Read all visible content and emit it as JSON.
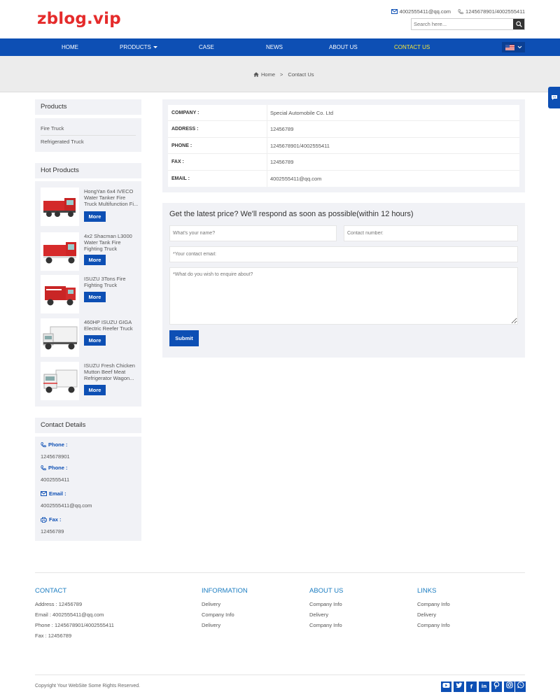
{
  "header": {
    "logo": "zblog.vip",
    "email": "4002555411@qq.com",
    "phone": "1245678901/4002555411",
    "search_placeholder": "Search here..."
  },
  "nav": {
    "items": [
      {
        "label": "HOME"
      },
      {
        "label": "PRODUCTS"
      },
      {
        "label": "CASE"
      },
      {
        "label": "NEWS"
      },
      {
        "label": "ABOUT US"
      },
      {
        "label": "CONTACT US"
      }
    ]
  },
  "breadcrumb": {
    "home": "Home",
    "sep": ">",
    "current": "Contact Us"
  },
  "sidebar": {
    "products_title": "Products",
    "products": [
      "Fire Truck",
      "Refrigerated Truck"
    ],
    "hot_title": "Hot Products",
    "more_label": "More",
    "hot": [
      {
        "name": "HongYan 6x4 IVECO Water Tanker Fire Truck Multifunction Fi..."
      },
      {
        "name": "4x2 Shacman L3000 Water Tank Fire Fighting Truck"
      },
      {
        "name": "ISUZU 3Tons Fire Fighting Truck"
      },
      {
        "name": "460HP ISUZU GIGA Electric Reefer Truck"
      },
      {
        "name": "ISUZU Fresh Chicken Mutton Beef Meat Refrigerator Wagon..."
      }
    ],
    "contact_title": "Contact Details",
    "contact": {
      "phone_label": "Phone :",
      "phone1": "1245678901",
      "phone2": "4002555411",
      "email_label": "Email :",
      "email": "4002555411@qq.com",
      "fax_label": "Fax :",
      "fax": "12456789"
    }
  },
  "info": {
    "rows": [
      {
        "key": "COMPANY :",
        "value": "Special Automobile Co. Ltd"
      },
      {
        "key": "ADDRESS :",
        "value": "12456789"
      },
      {
        "key": "PHONE :",
        "value": "1245678901/4002555411"
      },
      {
        "key": "FAX :",
        "value": "12456789"
      },
      {
        "key": "EMAIL :",
        "value": "4002555411@qq.com"
      }
    ]
  },
  "form": {
    "title": "Get the latest price? We'll respond as soon as possible(within 12 hours)",
    "name_placeholder": "What's your name?",
    "number_placeholder": "Contact number:",
    "email_placeholder": "*Your contact email:",
    "message_placeholder": "*What do you wish to enquire about?",
    "submit": "Submit"
  },
  "footer": {
    "contact": {
      "title": "CONTACT",
      "lines": [
        "Address : 12456789",
        "Email : 4002555411@qq.com",
        "Phone : 1245678901/4002555411",
        "Fax : 12456789"
      ]
    },
    "information": {
      "title": "INFORMATION",
      "links": [
        "Delivery",
        "Company Info",
        "Delivery"
      ]
    },
    "about": {
      "title": "ABOUT US",
      "links": [
        "Company Info",
        "Delivery",
        "Company Info"
      ]
    },
    "links": {
      "title": "LINKS",
      "links": [
        "Company Info",
        "Delivery",
        "Company Info"
      ]
    },
    "copyright": "Copyright Your WebSite Some Rights Reserved.",
    "social": [
      "youtube-icon",
      "twitter-icon",
      "facebook-icon",
      "linkedin-icon",
      "pinterest-icon",
      "instagram-icon",
      "whatsapp-icon"
    ]
  },
  "colors": {
    "brand": "#0d4fb4",
    "logo": "#e52b2b",
    "nav_active": "#f7e83a",
    "footer_heading": "#1a7cc1"
  }
}
